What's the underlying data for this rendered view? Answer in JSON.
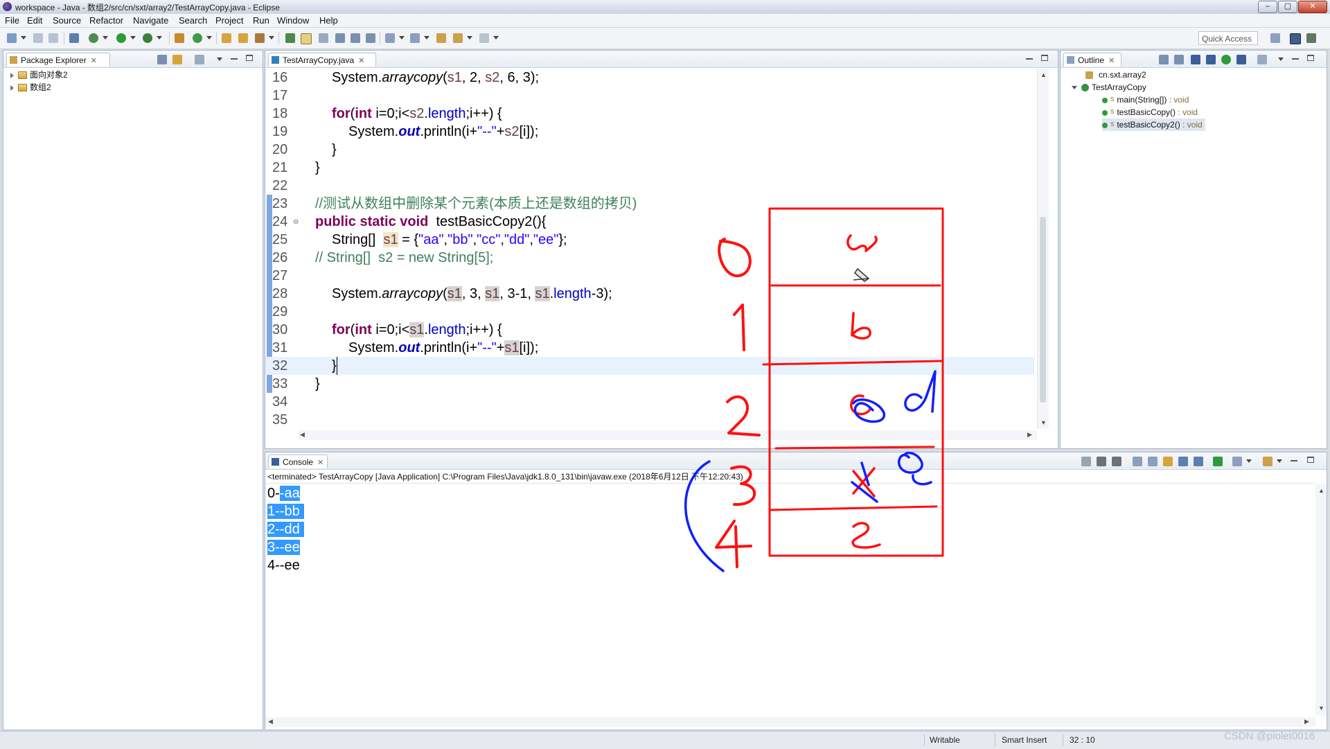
{
  "window": {
    "title": "workspace - Java - 数组2/src/cn/sxt/array2/TestArrayCopy.java - Eclipse",
    "controls": [
      "–",
      "▢",
      "✕"
    ]
  },
  "menubar": [
    "File",
    "Edit",
    "Source",
    "Refactor",
    "Navigate",
    "Search",
    "Project",
    "Run",
    "Window",
    "Help"
  ],
  "toolbar": {
    "quick_access": "Quick Access"
  },
  "package_explorer": {
    "tab_label": "Package Explorer",
    "projects": [
      "面向对象2",
      "数组2"
    ]
  },
  "editor": {
    "tab_label": "TestArrayCopy.java",
    "line_numbers": [
      "16",
      "17",
      "18",
      "19",
      "20",
      "21",
      "22",
      "23",
      "24",
      "25",
      "26",
      "27",
      "28",
      "29",
      "30",
      "31",
      "32",
      "33",
      "34",
      "35"
    ],
    "tokens": {
      "l16": [
        "System.",
        "arraycopy",
        "(",
        "s1",
        ", 2, ",
        "s2",
        ", 6, 3);"
      ],
      "l18": [
        "for",
        "(",
        "int",
        " i=0;i<",
        "s2",
        ".",
        "length",
        ";i++) {"
      ],
      "l19": [
        "System.",
        "out",
        ".println(i+",
        "\"--\"",
        "+",
        "s2",
        "[i]);"
      ],
      "l20": [
        "}"
      ],
      "l21": [
        "}"
      ],
      "l23": [
        "//测试从数组中删除某个元素(本质上还是数组的拷贝)"
      ],
      "l24": [
        "public static void",
        "  testBasicCopy2(){"
      ],
      "l25": [
        "String[]  ",
        "s1",
        " = {",
        "\"aa\"",
        ",",
        "\"bb\"",
        ",",
        "\"cc\"",
        ",",
        "\"dd\"",
        ",",
        "\"ee\"",
        "};"
      ],
      "l26": [
        "// String[]  s2 = new String[5];"
      ],
      "l28": [
        "System.",
        "arraycopy",
        "(",
        "s1",
        ", 3, ",
        "s1",
        ", 3-1, ",
        "s1",
        ".",
        "length",
        "-3);"
      ],
      "l30": [
        "for",
        "(",
        "int",
        " i=0;i<",
        "s1",
        ".",
        "length",
        ";i++) {"
      ],
      "l31": [
        "System.",
        "out",
        ".println(i+",
        "\"--\"",
        "+",
        "s1",
        "[i]);"
      ],
      "l32": [
        "}"
      ],
      "l33": [
        "}"
      ]
    }
  },
  "outline": {
    "tab_label": "Outline",
    "package": "cn.sxt.array2",
    "class": "TestArrayCopy",
    "members": [
      {
        "name": "main(String[])",
        "sig": " : void"
      },
      {
        "name": "testBasicCopy()",
        "sig": " : void"
      },
      {
        "name": "testBasicCopy2()",
        "sig": " : void"
      }
    ],
    "static_marker": "S"
  },
  "console": {
    "tab_label": "Console",
    "header": "<terminated> TestArrayCopy [Java Application] C:\\Program Files\\Java\\jdk1.8.0_131\\bin\\javaw.exe (2018年6月12日 下午12:20:43)",
    "lines": [
      {
        "prefix": "0-",
        "selected": "-aa"
      },
      {
        "prefix": "",
        "selected": "1--bb"
      },
      {
        "prefix": "",
        "selected": "2--dd"
      },
      {
        "prefix": "",
        "selected": "3--ee"
      },
      {
        "prefix": "4--ee",
        "selected": ""
      }
    ]
  },
  "annotation": {
    "index_labels": [
      "0",
      "1",
      "2",
      "3",
      "4"
    ],
    "cell_letters": [
      "a",
      "b",
      "c",
      "x",
      "e"
    ],
    "blue_letters": [
      "d",
      "e"
    ],
    "colors": {
      "red": "#ff1010",
      "blue": "#1020ff"
    }
  },
  "statusbar": {
    "writable": "Writable",
    "insert_mode": "Smart Insert",
    "position": "32 : 10"
  },
  "watermark": "CSDN @piolet0016"
}
